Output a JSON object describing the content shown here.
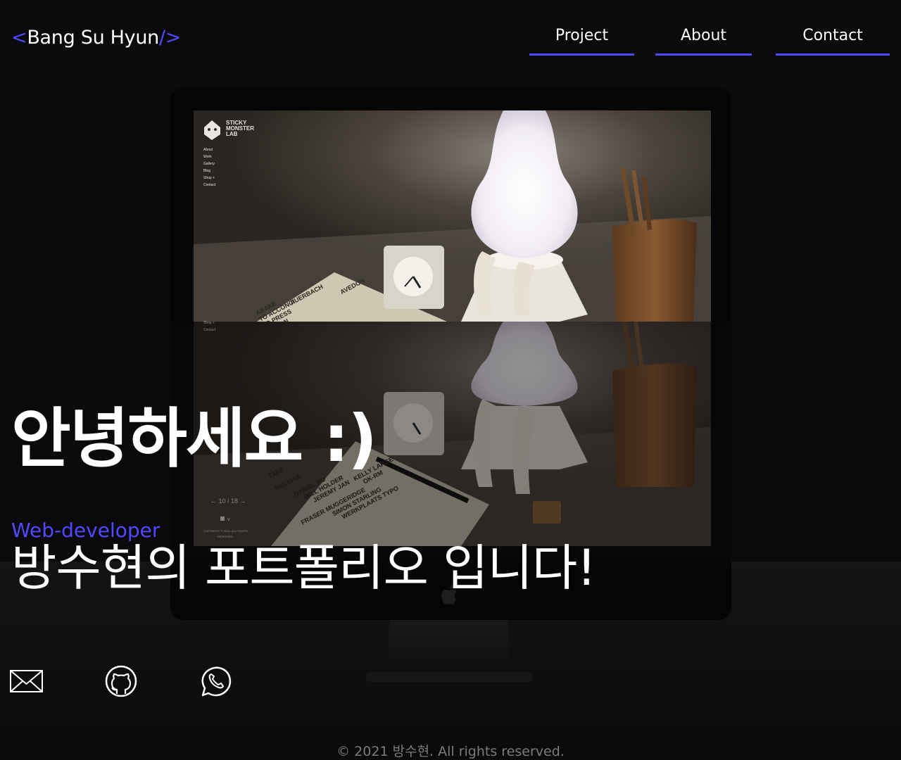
{
  "header": {
    "logo_open": "<",
    "logo_name": "Bang Su Hyun",
    "logo_close": "/>",
    "nav": [
      "Project",
      "About",
      "Contact"
    ]
  },
  "hero": {
    "greeting": "안녕하세요 :)",
    "role": "Web-developer",
    "intro": "방수현의 포트폴리오 입니다!"
  },
  "screen_site": {
    "brand": [
      "STICKY",
      "MONSTER",
      "LAB"
    ],
    "menu": [
      "About",
      "Work",
      "Gallery",
      "Blog",
      "Shop +",
      "Contact"
    ],
    "menu_repeat": [
      "Shop +",
      "Contact"
    ],
    "pager": "← 10 / 18 →",
    "copyright": [
      "COPYRIGHT © 2016. ALL RIGHTS",
      "RESERVED."
    ],
    "book_lines": [
      "ABAKE",
      "TO ACCONCI",
      "AUERBACH",
      "ED PRESS",
      "ARBION",
      "AVEDON"
    ],
    "book_lines_lower": [
      "TAKE",
      "MELISSA",
      "DANIEL HO",
      "WILL HOLDER",
      "JEREMY JAN",
      "KELLY LARGE",
      "OK-RM",
      "FRASER MUGGERIDGE",
      "SIMON STARLING",
      "WERKPLAATS TYPO"
    ]
  },
  "social": [
    {
      "icon": "mail-icon"
    },
    {
      "icon": "github-icon"
    },
    {
      "icon": "whatsapp-icon"
    }
  ],
  "footer": {
    "text": "© 2021 방수현. All rights reserved."
  },
  "colors": {
    "accent": "#4f49ff",
    "background": "#0b0a0c",
    "footer_text": "#7b7a7d"
  }
}
